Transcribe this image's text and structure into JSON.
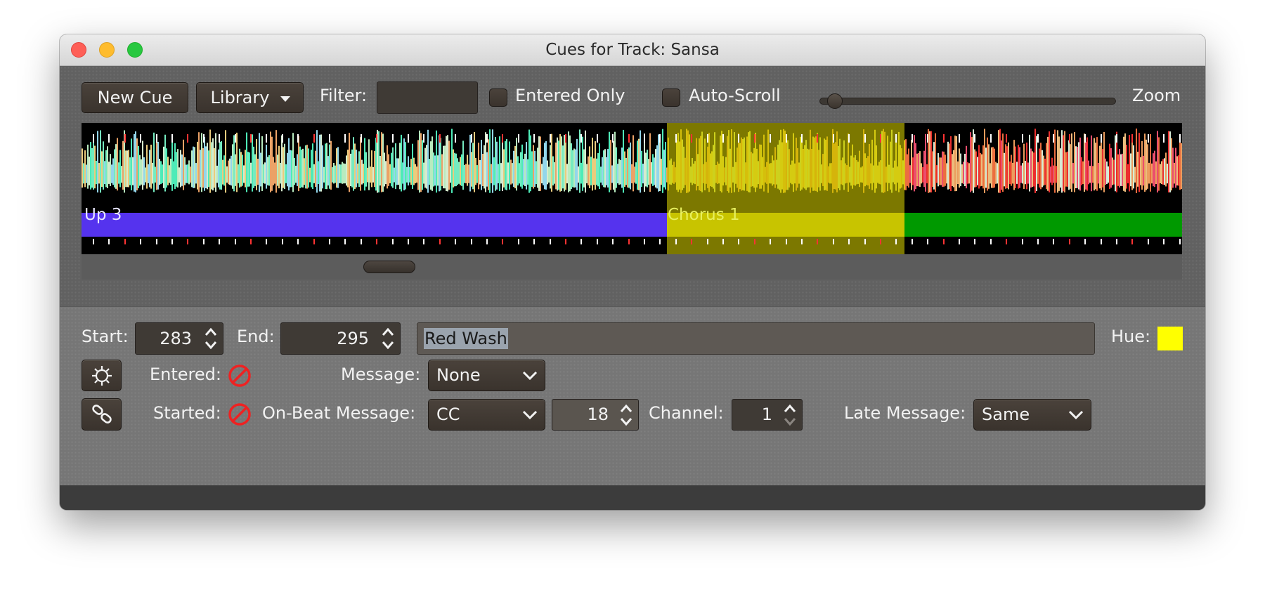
{
  "window": {
    "title": "Cues for Track: Sansa"
  },
  "toolbar": {
    "new_cue_label": "New Cue",
    "library_label": "Library",
    "filter_label": "Filter:",
    "filter_value": "",
    "entered_only_label": "Entered Only",
    "entered_only_checked": false,
    "auto_scroll_label": "Auto-Scroll",
    "auto_scroll_checked": false,
    "zoom_label": "Zoom",
    "zoom_level": 0.05
  },
  "waveform": {
    "cues": [
      {
        "name": "Up 3",
        "color": "#5533ee"
      },
      {
        "name": "Chorus 1",
        "color": "#c8c800"
      },
      {
        "name": "",
        "color": "#009900"
      }
    ],
    "selected_overlay_color": "#c8c200",
    "beat_marker_color": "#ffffff",
    "bar_marker_color": "#ff3333"
  },
  "editor": {
    "start_label": "Start:",
    "start_value": "283",
    "end_label": "End:",
    "end_value": "295",
    "comment_value": "Red Wash",
    "hue_label": "Hue:",
    "hue_color": "#ffff00",
    "entered_label": "Entered:",
    "message_label": "Message:",
    "message_value": "None",
    "started_label": "Started:",
    "onbeat_label": "On-Beat Message:",
    "onbeat_value": "CC",
    "onbeat_number": "18",
    "channel_label": "Channel:",
    "channel_value": "1",
    "late_label": "Late Message:",
    "late_value": "Same",
    "status_icon_color": "#ee2222"
  }
}
